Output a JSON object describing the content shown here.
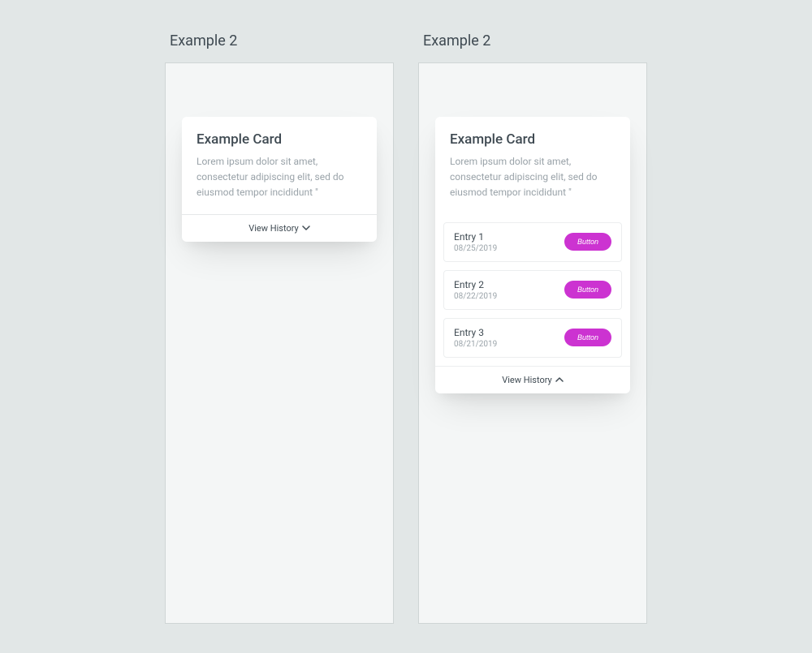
{
  "example_label_left": "Example 2",
  "example_label_right": "Example 2",
  "card": {
    "title": "Example Card",
    "description": "Lorem ipsum dolor sit amet, consectetur adipiscing elit, sed do eiusmod tempor incididunt \""
  },
  "view_history_label": "View History",
  "entries": [
    {
      "title": "Entry 1",
      "date": "08/25/2019",
      "button": "Button"
    },
    {
      "title": "Entry 2",
      "date": "08/22/2019",
      "button": "Button"
    },
    {
      "title": "Entry 3",
      "date": "08/21/2019",
      "button": "Button"
    }
  ],
  "colors": {
    "accent": "#cc33d1"
  }
}
